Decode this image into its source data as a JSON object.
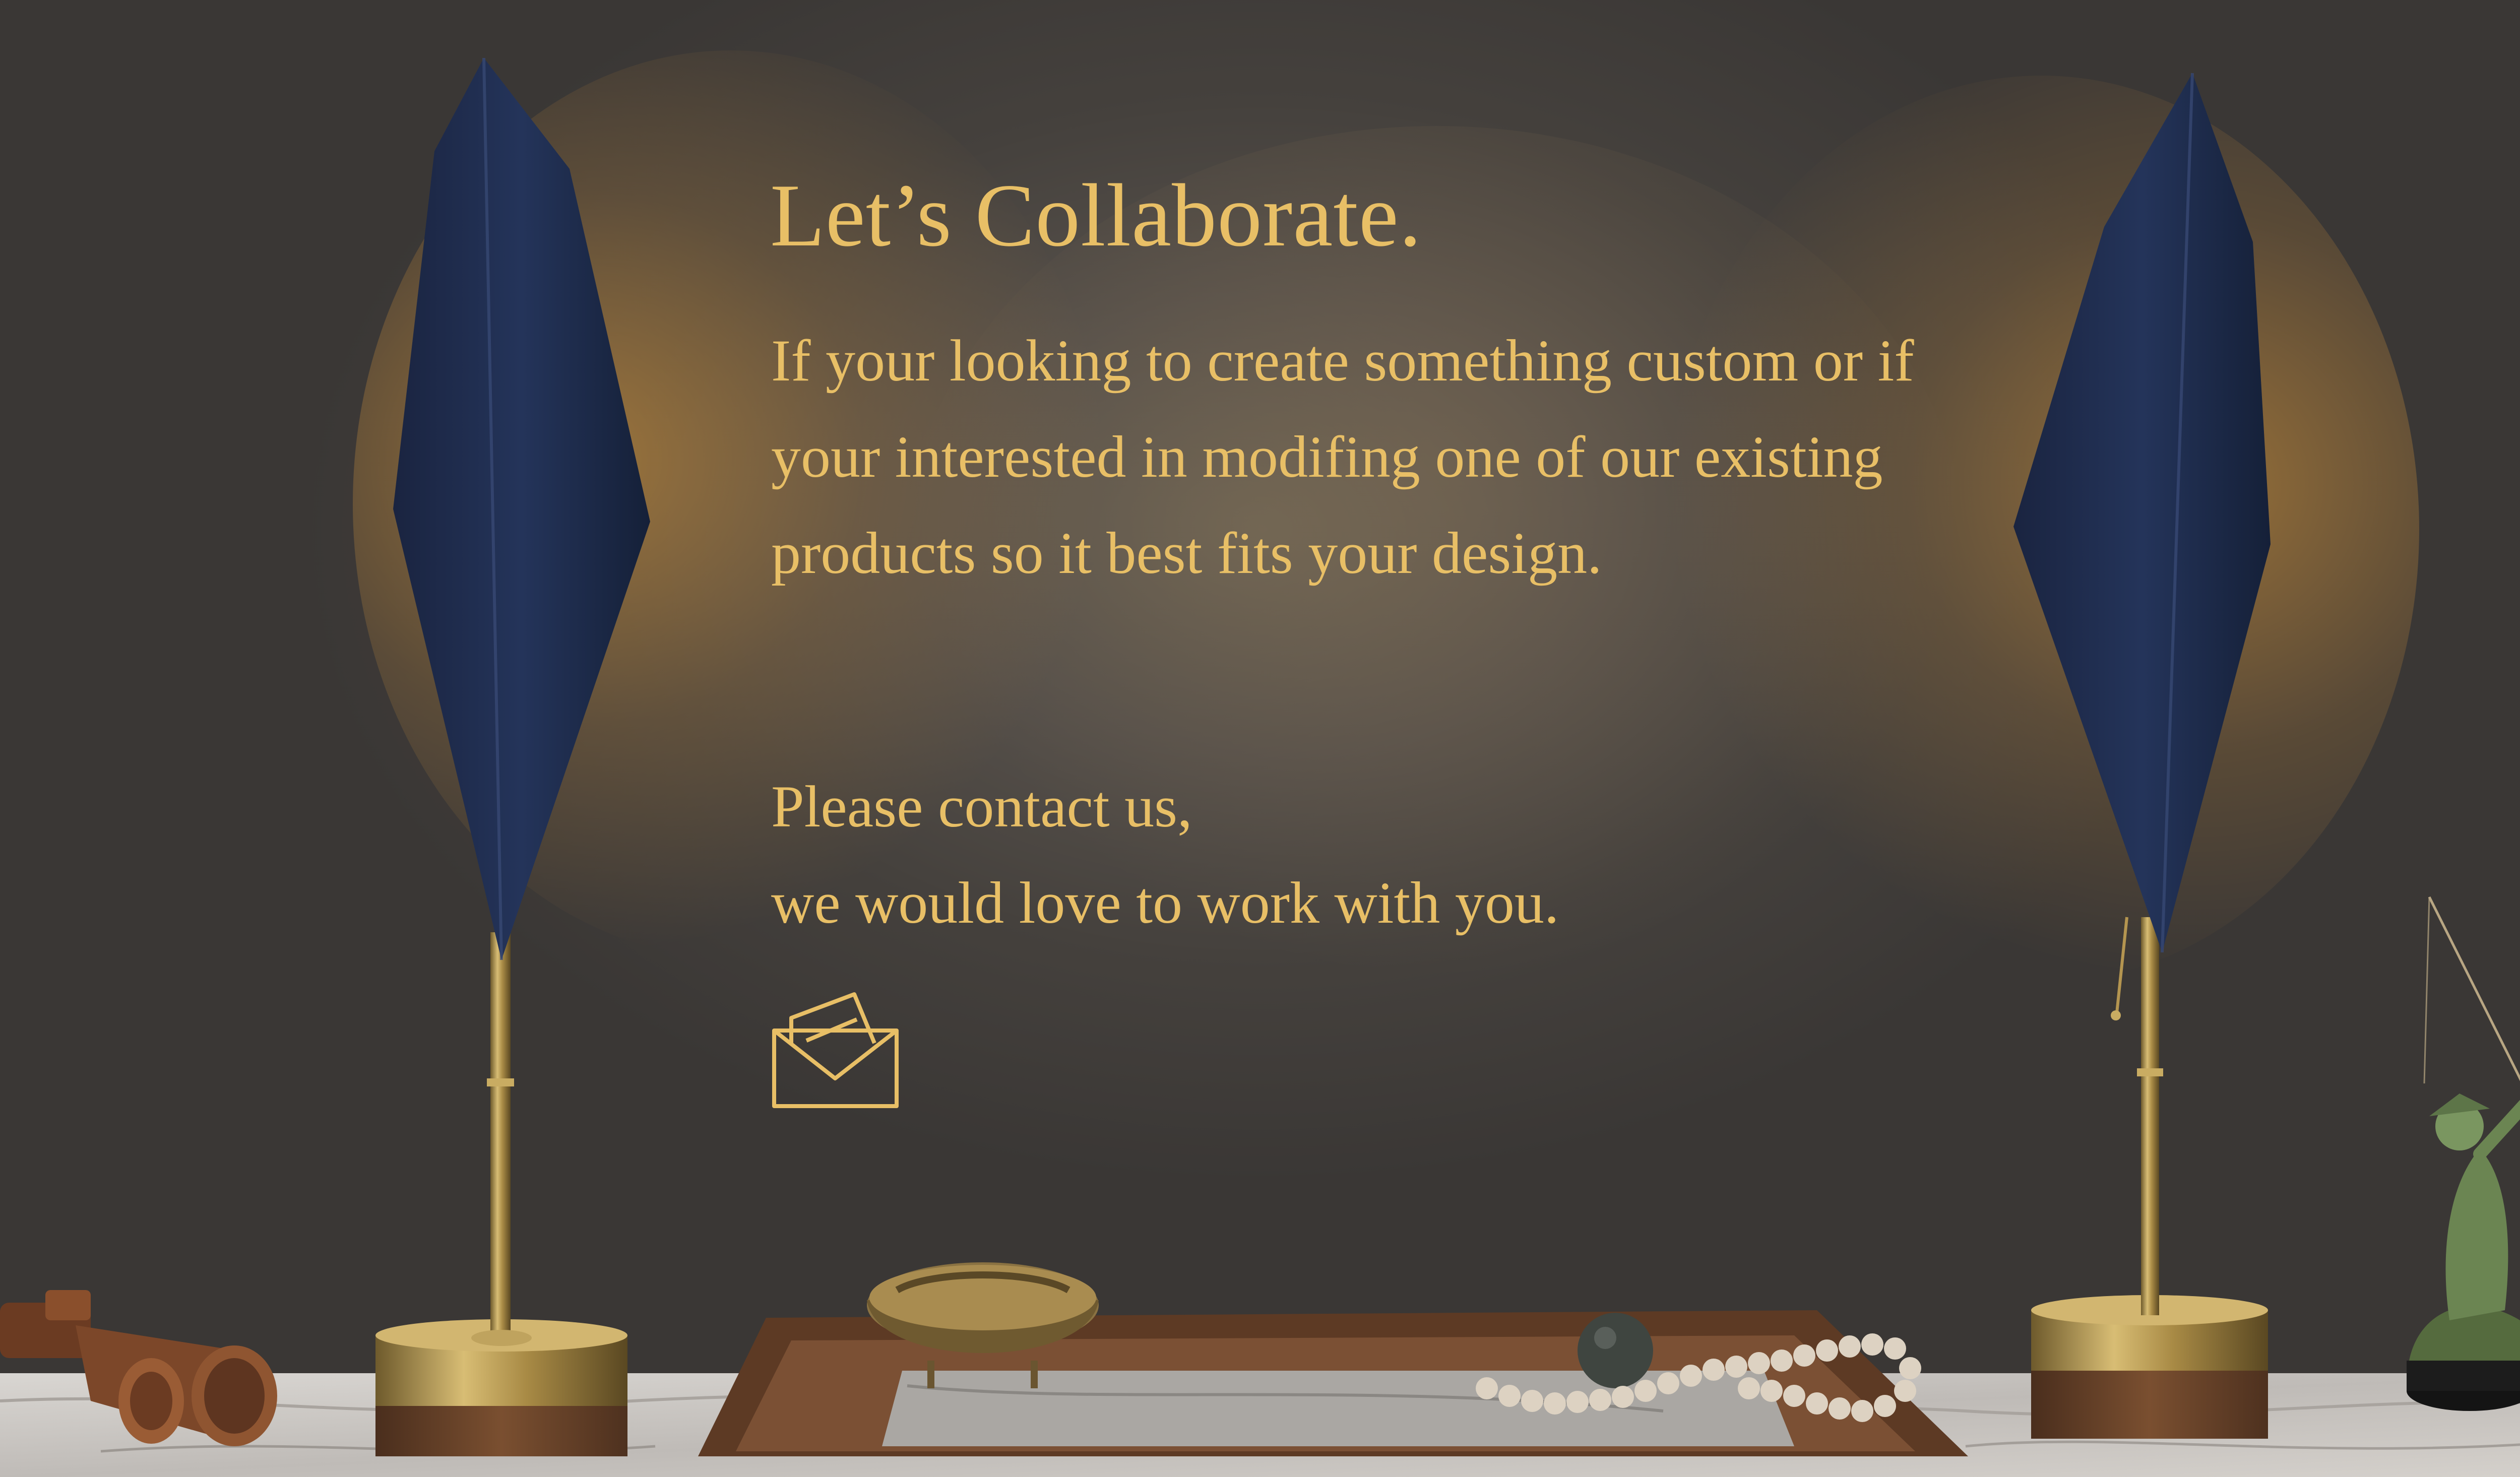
{
  "collaborate": {
    "heading": "Let’s Collaborate.",
    "intro": "If your looking to create something custom or if your interested in modifing one of our existing products so it best fits your design.",
    "contact_line_1": "Please contact us,",
    "contact_line_2": "we would love to work with you."
  },
  "icons": {
    "mail": "envelope-icon"
  },
  "colors": {
    "text": "#e8bf66",
    "shade": "#1f2c47",
    "brass": "#b89a55",
    "wall": "#45413d"
  }
}
